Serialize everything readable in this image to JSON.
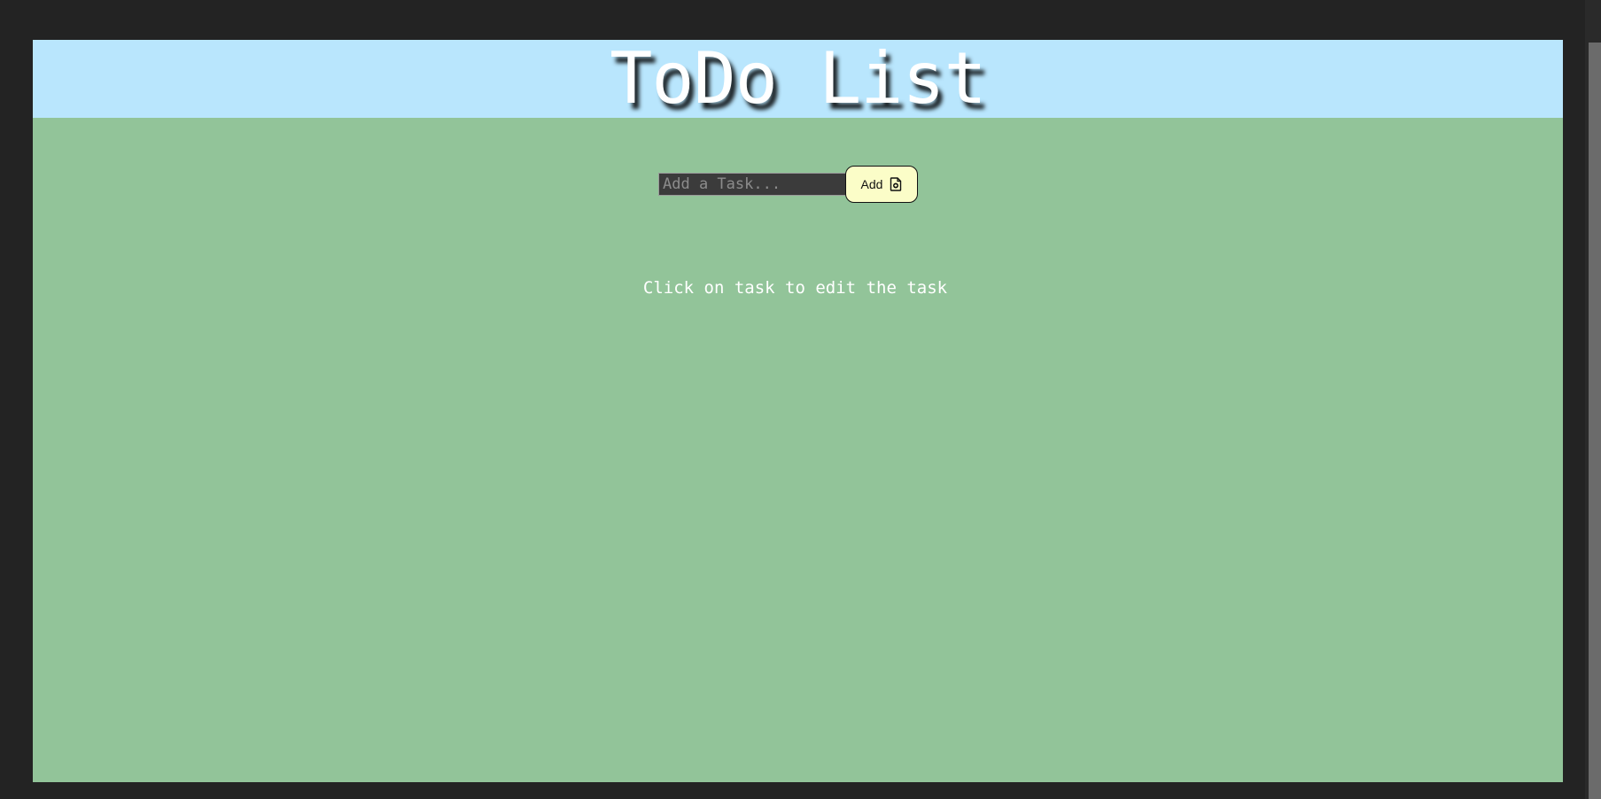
{
  "header": {
    "title": "ToDo List"
  },
  "form": {
    "input_placeholder": "Add a Task...",
    "input_value": "",
    "add_button_label": "Add",
    "add_button_icon": "file-plus-icon"
  },
  "hint_text": "Click on task to edit the task",
  "colors": {
    "page_background": "#232323",
    "header_background": "#b9e6fd",
    "body_background": "#92c499",
    "button_background": "#fbfdc8",
    "input_background": "#3b3b3b"
  }
}
